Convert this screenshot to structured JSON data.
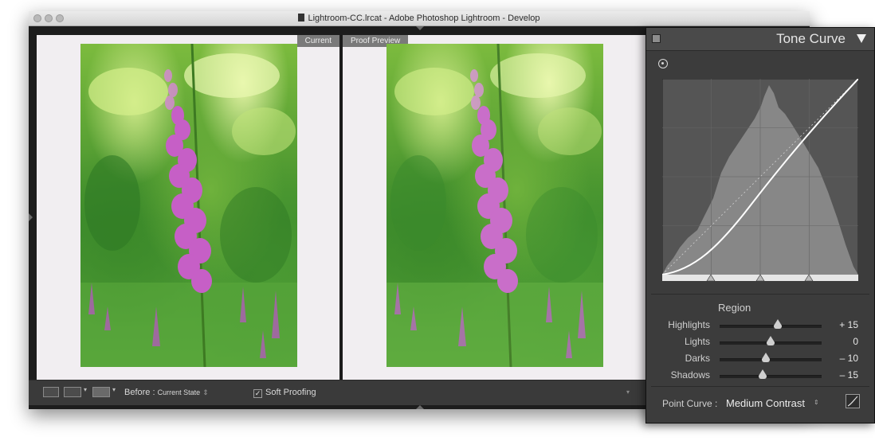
{
  "window": {
    "title": "Lightroom-CC.lrcat - Adobe Photoshop Lightroom - Develop"
  },
  "compare": {
    "left_label": "Current",
    "right_label": "Proof Preview"
  },
  "toolbar": {
    "before_label": "Before :",
    "before_value": "Current State",
    "soft_proofing_label": "Soft Proofing",
    "soft_proofing_checked": true
  },
  "tone_curve": {
    "title": "Tone Curve",
    "region_title": "Region",
    "sliders": [
      {
        "label": "Highlights",
        "value_text": "+ 15",
        "value": 15
      },
      {
        "label": "Lights",
        "value_text": "0",
        "value": 0
      },
      {
        "label": "Darks",
        "value_text": "– 10",
        "value": -10
      },
      {
        "label": "Shadows",
        "value_text": "– 15",
        "value": -15
      }
    ],
    "point_curve_label": "Point Curve :",
    "point_curve_value": "Medium Contrast",
    "colors": {
      "panel_bg": "#3c3c3c",
      "graph_bg": "#555555",
      "histogram": "#8a8a8a",
      "curve": "#ffffff"
    }
  }
}
